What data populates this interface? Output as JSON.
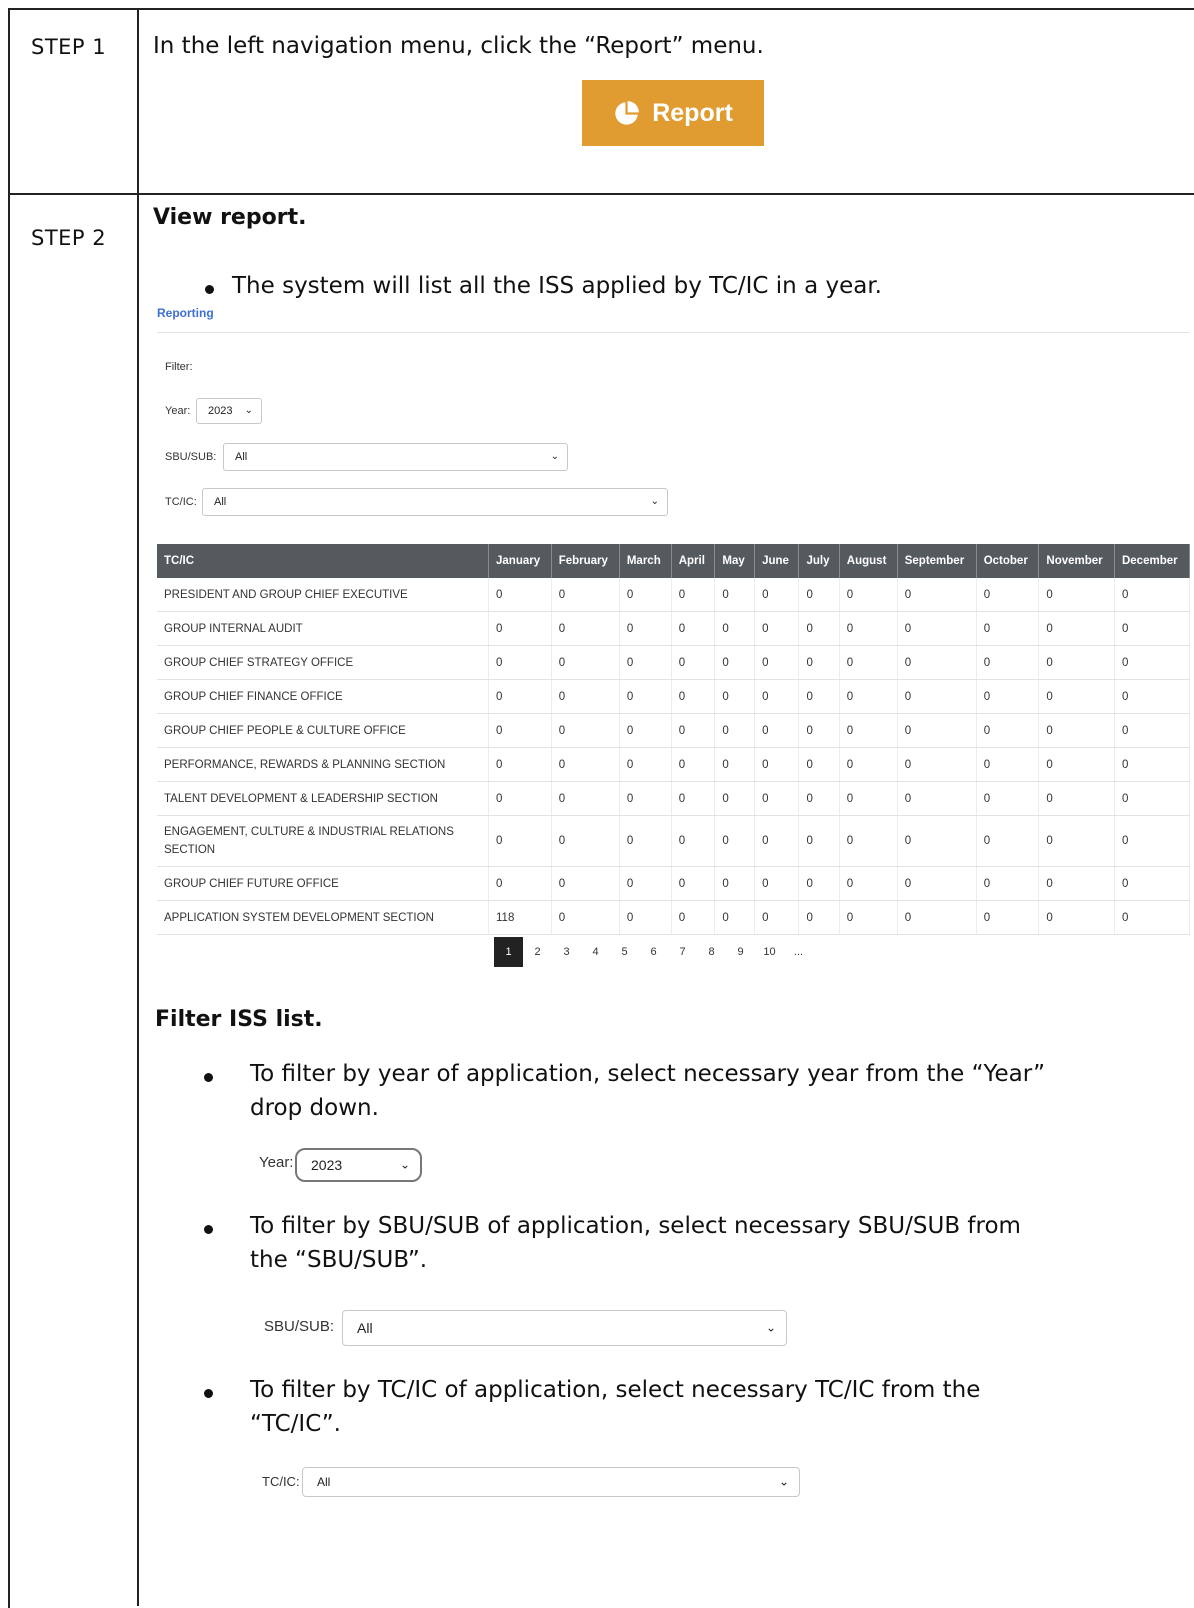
{
  "step1": {
    "label": "STEP  1",
    "instruction": "In the left navigation menu, click the “Report” menu.",
    "button_label": "Report",
    "button_color": "#e09c31"
  },
  "step2": {
    "label": "STEP 2",
    "heading_view": "View report.",
    "bullet_view": "The system will list all the ISS applied by TC/IC in a year.",
    "heading_filter": "Filter ISS list.",
    "bullet_year_1": "To filter by year of application, select necessary year from the “Year”",
    "bullet_year_2": "drop down.",
    "bullet_sbu_1": "To filter by SBU/SUB of application, select necessary SBU/SUB from",
    "bullet_sbu_2": "the “SBU/SUB”.",
    "bullet_tcic_1": "To filter by TC/IC of application, select necessary TC/IC from the",
    "bullet_tcic_2": "“TC/IC”."
  },
  "report": {
    "title": "Reporting",
    "filter_label": "Filter:",
    "year_label": "Year:",
    "year_value": "2023",
    "sbu_label": "SBU/SUB:",
    "sbu_value": "All",
    "tcic_label": "TC/IC:",
    "tcic_value": "All",
    "columns": [
      "TC/IC",
      "January",
      "February",
      "March",
      "April",
      "May",
      "June",
      "July",
      "August",
      "September",
      "October",
      "November",
      "December"
    ],
    "rows": [
      [
        "PRESIDENT AND GROUP CHIEF EXECUTIVE",
        "0",
        "0",
        "0",
        "0",
        "0",
        "0",
        "0",
        "0",
        "0",
        "0",
        "0",
        "0"
      ],
      [
        "GROUP INTERNAL AUDIT",
        "0",
        "0",
        "0",
        "0",
        "0",
        "0",
        "0",
        "0",
        "0",
        "0",
        "0",
        "0"
      ],
      [
        "GROUP CHIEF STRATEGY OFFICE",
        "0",
        "0",
        "0",
        "0",
        "0",
        "0",
        "0",
        "0",
        "0",
        "0",
        "0",
        "0"
      ],
      [
        "GROUP CHIEF FINANCE OFFICE",
        "0",
        "0",
        "0",
        "0",
        "0",
        "0",
        "0",
        "0",
        "0",
        "0",
        "0",
        "0"
      ],
      [
        "GROUP CHIEF PEOPLE & CULTURE OFFICE",
        "0",
        "0",
        "0",
        "0",
        "0",
        "0",
        "0",
        "0",
        "0",
        "0",
        "0",
        "0"
      ],
      [
        "PERFORMANCE, REWARDS & PLANNING SECTION",
        "0",
        "0",
        "0",
        "0",
        "0",
        "0",
        "0",
        "0",
        "0",
        "0",
        "0",
        "0"
      ],
      [
        "TALENT DEVELOPMENT & LEADERSHIP SECTION",
        "0",
        "0",
        "0",
        "0",
        "0",
        "0",
        "0",
        "0",
        "0",
        "0",
        "0",
        "0"
      ],
      [
        "ENGAGEMENT, CULTURE & INDUSTRIAL RELATIONS SECTION",
        "0",
        "0",
        "0",
        "0",
        "0",
        "0",
        "0",
        "0",
        "0",
        "0",
        "0",
        "0"
      ],
      [
        "GROUP CHIEF FUTURE OFFICE",
        "0",
        "0",
        "0",
        "0",
        "0",
        "0",
        "0",
        "0",
        "0",
        "0",
        "0",
        "0"
      ],
      [
        "APPLICATION SYSTEM DEVELOPMENT SECTION",
        "118",
        "0",
        "0",
        "0",
        "0",
        "0",
        "0",
        "0",
        "0",
        "0",
        "0",
        "0"
      ]
    ],
    "pages": [
      "1",
      "2",
      "3",
      "4",
      "5",
      "6",
      "7",
      "8",
      "9",
      "10",
      "..."
    ],
    "active_page": "1"
  },
  "zoom": {
    "year_label": "Year:",
    "year_value": "2023",
    "sbu_label": "SBU/SUB:",
    "sbu_value": "All",
    "tcic_label": "TC/IC:",
    "tcic_value": "All"
  }
}
